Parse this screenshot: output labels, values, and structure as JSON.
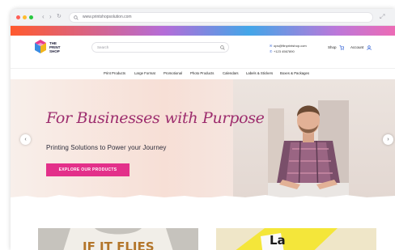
{
  "browser": {
    "url": "www.printshopsolution.com",
    "back_icon": "chevron-left-icon",
    "forward_icon": "chevron-right-icon",
    "reload_icon": "reload-icon",
    "expand_icon": "expand-icon"
  },
  "brand": {
    "name_line1": "THE",
    "name_line2": "PRINT",
    "name_line3": "SHOP"
  },
  "search": {
    "placeholder": "Search"
  },
  "contact": {
    "email": "ops@fiinprintshop.com",
    "phone": "+123 4567890"
  },
  "header_links": {
    "shop": "Shop",
    "account": "Account"
  },
  "menu": [
    "Print Products",
    "Large Format",
    "Promotional",
    "Photo Products",
    "Calendars",
    "Labels & Stickers",
    "Boxes & Packages"
  ],
  "hero": {
    "script_title": "For Businesses with Purpose",
    "subtitle": "Printing Solutions to Power your Journey",
    "cta": "EXPLORE OUR PRODUCTS"
  },
  "cards": [
    {
      "text": "IF IT FLIES"
    },
    {
      "text": "La"
    }
  ],
  "colors": {
    "accent": "#e3308a",
    "script": "#9d2d6e"
  }
}
